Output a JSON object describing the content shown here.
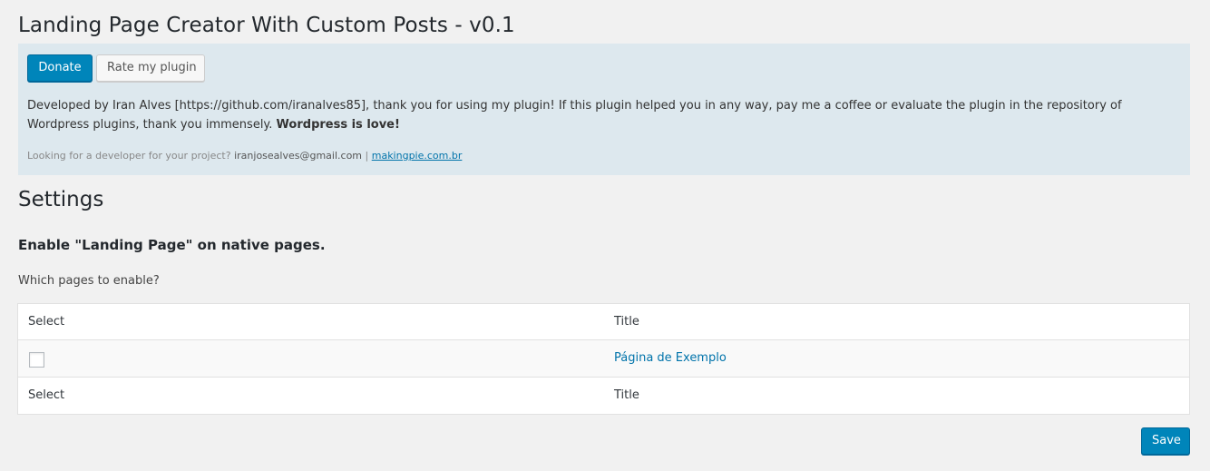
{
  "page": {
    "title": "Landing Page Creator With Custom Posts - v0.1"
  },
  "info": {
    "donate_label": "Donate",
    "rate_label": "Rate my plugin",
    "description": "Developed by Iran Alves [https://github.com/iranalves85], thank you for using my plugin! If this plugin helped you in any way, pay me a coffee or evaluate the plugin in the repository of Wordpress plugins, thank you immensely.",
    "description_strong": "Wordpress is love!",
    "footer_prefix": "Looking for a developer for your project?",
    "footer_email": "iranjosealves@gmail.com",
    "footer_separator": "|",
    "footer_link": "makingpie.com.br"
  },
  "settings": {
    "title": "Settings",
    "section_title": "Enable \"Landing Page\" on native pages.",
    "section_desc": "Which pages to enable?"
  },
  "table": {
    "header": {
      "select": "Select",
      "title": "Title"
    },
    "rows": [
      {
        "checked": false,
        "title": "Página de Exemplo"
      }
    ],
    "footer": {
      "select": "Select",
      "title": "Title"
    }
  },
  "actions": {
    "save_label": "Save"
  },
  "colors": {
    "primary": "#0085ba",
    "link": "#0073aa",
    "info_bg": "#dde8ee",
    "page_bg": "#f1f1f1"
  }
}
